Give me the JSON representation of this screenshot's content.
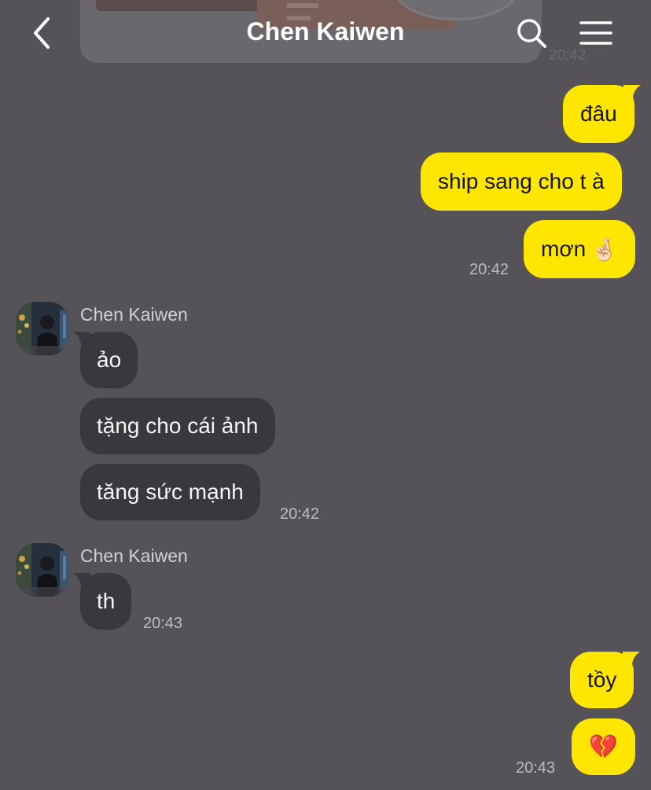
{
  "header": {
    "title": "Chen Kaiwen"
  },
  "top_preview": {
    "time": "20:42"
  },
  "messages": {
    "m1": "đâu",
    "m2": "ship sang cho t à",
    "m3": "mơn",
    "m3_emoji": "🤞🏻",
    "t1": "20:42",
    "g1_sender": "Chen Kaiwen",
    "r1": "ảo",
    "r2": "tặng cho cái ảnh",
    "r3": "tăng sức mạnh",
    "t2": "20:42",
    "g2_sender": "Chen Kaiwen",
    "r4": "th",
    "t3": "20:43",
    "m4": "tồy",
    "m5": "💔",
    "t4": "20:43"
  },
  "colors": {
    "background": "#555357",
    "my_bubble": "#ffe600",
    "their_bubble": "#3a383c"
  }
}
